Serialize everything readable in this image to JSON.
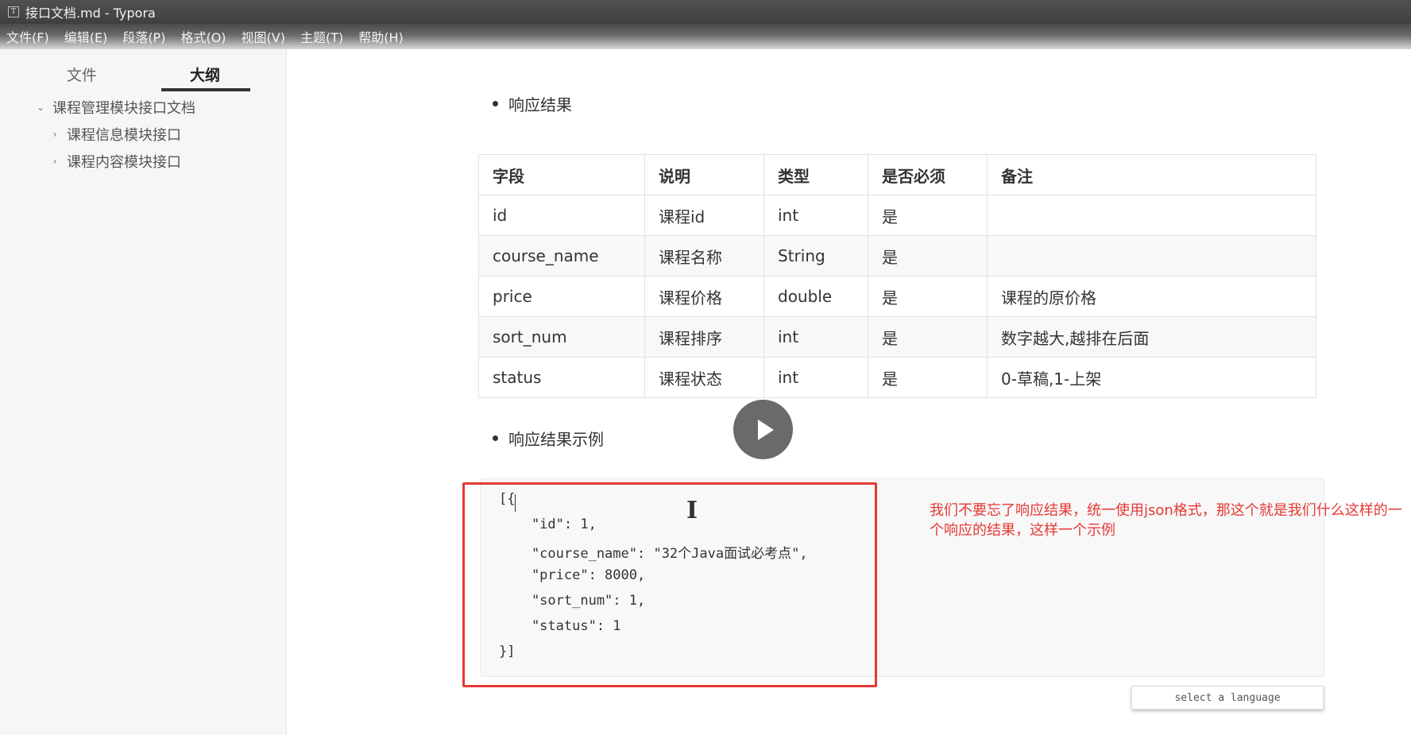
{
  "window": {
    "title": "接口文档.md - Typora",
    "app_icon": "T"
  },
  "menu": [
    "文件(F)",
    "编辑(E)",
    "段落(P)",
    "格式(O)",
    "视图(V)",
    "主题(T)",
    "帮助(H)"
  ],
  "sidebar": {
    "tabs": {
      "files": "文件",
      "outline": "大纲",
      "active": "outline"
    },
    "outline": [
      {
        "label": "课程管理模块接口文档",
        "expanded": true,
        "level": 1
      },
      {
        "label": "课程信息模块接口",
        "expanded": false,
        "level": 2
      },
      {
        "label": "课程内容模块接口",
        "expanded": false,
        "level": 2
      }
    ]
  },
  "doc": {
    "section1": "响应结果",
    "table": {
      "headers": [
        "字段",
        "说明",
        "类型",
        "是否必须",
        "备注"
      ],
      "rows": [
        [
          "id",
          "课程id",
          "int",
          "是",
          ""
        ],
        [
          "course_name",
          "课程名称",
          "String",
          "是",
          ""
        ],
        [
          "price",
          "课程价格",
          "double",
          "是",
          "课程的原价格"
        ],
        [
          "sort_num",
          "课程排序",
          "int",
          "是",
          "数字越大,越排在后面"
        ],
        [
          "status",
          "课程状态",
          "int",
          "是",
          "0-草稿,1-上架"
        ]
      ]
    },
    "section2": "响应结果示例",
    "code": [
      "[{",
      "    \"id\": 1,",
      "    \"course_name\": \"32个Java面试必考点\",",
      "    \"price\": 8000,",
      "    \"sort_num\": 1,",
      "    \"status\": 1",
      "}]"
    ],
    "language_placeholder": "select a language"
  },
  "annotation": "我们不要忘了响应结果，统一使用json格式，那这个就是我们什么这样的一个响应的结果，这样一个示例",
  "colors": {
    "highlight": "#e53935",
    "annotation_text": "#e53935"
  }
}
